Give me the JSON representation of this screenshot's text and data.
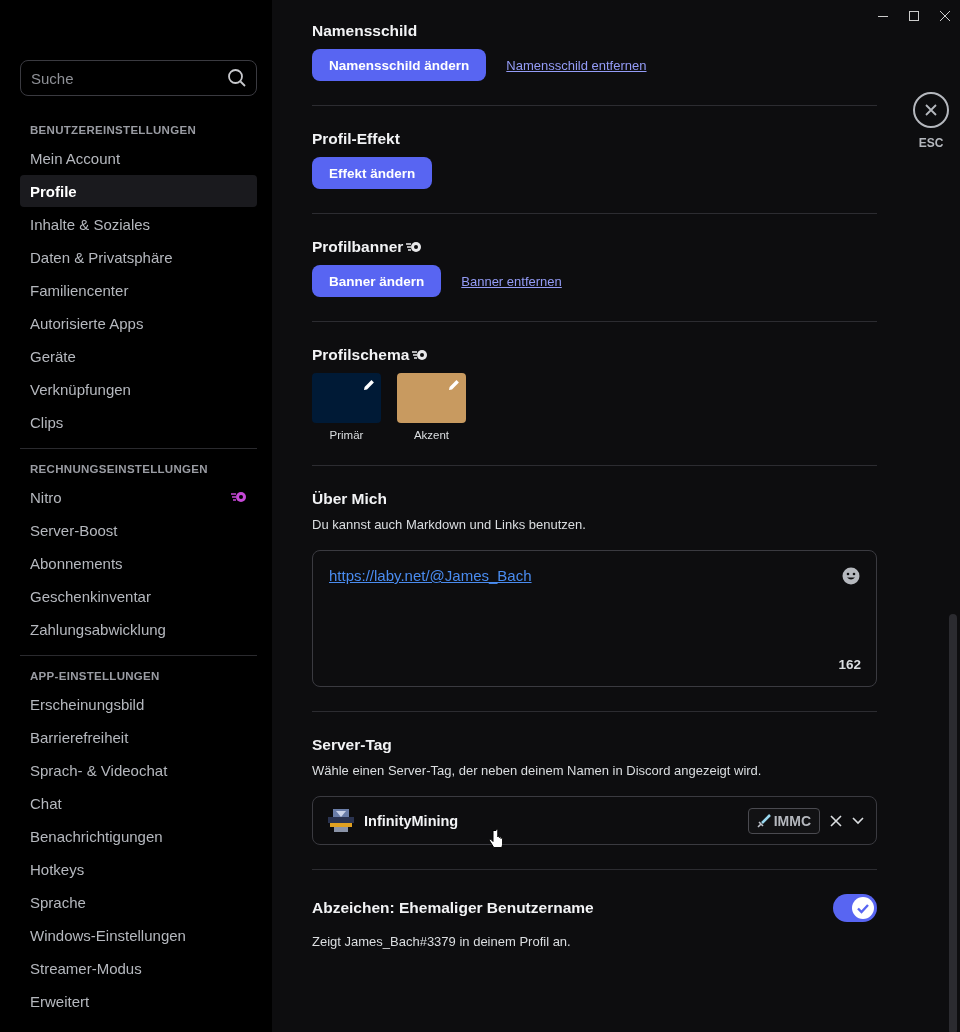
{
  "sidebar": {
    "search": {
      "placeholder": "Suche"
    },
    "sections": [
      {
        "heading": "BENUTZEREINSTELLUNGEN",
        "items": [
          {
            "label": "Mein Account",
            "selected": false,
            "kind": "plain"
          },
          {
            "label": "Profile",
            "selected": true,
            "kind": "plain"
          },
          {
            "label": "Inhalte & Soziales",
            "selected": false,
            "kind": "plain"
          },
          {
            "label": "Daten & Privatsphäre",
            "selected": false,
            "kind": "plain"
          },
          {
            "label": "Familiencenter",
            "selected": false,
            "kind": "plain"
          },
          {
            "label": "Autorisierte Apps",
            "selected": false,
            "kind": "plain"
          },
          {
            "label": "Geräte",
            "selected": false,
            "kind": "plain"
          },
          {
            "label": "Verknüpfungen",
            "selected": false,
            "kind": "plain"
          },
          {
            "label": "Clips",
            "selected": false,
            "kind": "plain"
          }
        ]
      },
      {
        "heading": "RECHNUNGSEINSTELLUNGEN",
        "items": [
          {
            "label": "Nitro",
            "selected": false,
            "kind": "nitro"
          },
          {
            "label": "Server-Boost",
            "selected": false,
            "kind": "plain"
          },
          {
            "label": "Abonnements",
            "selected": false,
            "kind": "plain"
          },
          {
            "label": "Geschenkinventar",
            "selected": false,
            "kind": "plain"
          },
          {
            "label": "Zahlungsabwicklung",
            "selected": false,
            "kind": "plain"
          }
        ]
      },
      {
        "heading": "APP-EINSTELLUNGEN",
        "items": [
          {
            "label": "Erscheinungsbild",
            "selected": false,
            "kind": "plain"
          },
          {
            "label": "Barrierefreiheit",
            "selected": false,
            "kind": "plain"
          },
          {
            "label": "Sprach- & Videochat",
            "selected": false,
            "kind": "plain"
          },
          {
            "label": "Chat",
            "selected": false,
            "kind": "plain"
          },
          {
            "label": "Benachrichtigungen",
            "selected": false,
            "kind": "plain"
          },
          {
            "label": "Hotkeys",
            "selected": false,
            "kind": "plain"
          },
          {
            "label": "Sprache",
            "selected": false,
            "kind": "plain"
          },
          {
            "label": "Windows-Einstellungen",
            "selected": false,
            "kind": "plain"
          },
          {
            "label": "Streamer-Modus",
            "selected": false,
            "kind": "plain"
          },
          {
            "label": "Erweitert",
            "selected": false,
            "kind": "plain"
          }
        ]
      }
    ]
  },
  "sections": [
    {
      "kind": "actions",
      "title": "Namensschild",
      "nitro": false,
      "button": "Namensschild ändern",
      "link": "Namensschild entfernen"
    },
    {
      "kind": "actions",
      "title": "Profil-Effekt",
      "nitro": false,
      "button": "Effekt ändern"
    },
    {
      "kind": "actions",
      "title": "Profilbanner",
      "nitro": true,
      "button": "Banner ändern",
      "link": "Banner entfernen"
    },
    {
      "kind": "colors",
      "title": "Profilschema",
      "nitro": true,
      "swatches": [
        {
          "label": "Primär",
          "color": "#001a36"
        },
        {
          "label": "Akzent",
          "color": "#c89a60"
        }
      ]
    },
    {
      "kind": "bio",
      "title": "Über Mich",
      "description": "Du kannst auch Markdown und Links benutzen.",
      "value": "https://laby.net/@James_Bach",
      "counter": "162"
    },
    {
      "kind": "server_tag",
      "title": "Server-Tag",
      "description": "Wähle einen Server-Tag, der neben deinem Namen in Discord angezeigt wird.",
      "server": "InfinityMining",
      "tag": "IMMC"
    },
    {
      "kind": "toggle",
      "title": "Abzeichen: Ehemaliger Benutzername",
      "description": "Zeigt James_Bach#3379 in deinem Profil an.",
      "on": true
    }
  ],
  "close": {
    "label": "ESC"
  }
}
